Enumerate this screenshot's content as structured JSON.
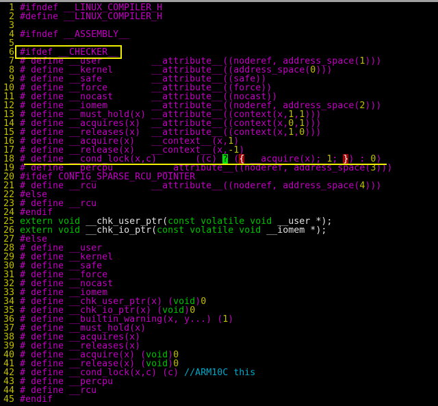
{
  "colors": {
    "preproc": "#c000c0",
    "number": "#c0c000",
    "type": "#00c000",
    "comment": "#00a8c8",
    "match": "#a80000",
    "cursor": "#00e000",
    "highlight": "#f0f000"
  },
  "lines": [
    [
      [
        "p",
        "#ifndef __LINUX_COMPILER_H"
      ]
    ],
    [
      [
        "p",
        "#define __LINUX_COMPILER_H"
      ]
    ],
    [],
    [
      [
        "p",
        "#ifndef __ASSEMBLY__"
      ]
    ],
    [],
    [
      [
        "p",
        "#ifdef __CHECKER__"
      ]
    ],
    [
      [
        "p",
        "# define __user         __attribute__((noderef, address_space("
      ],
      [
        "n",
        "1"
      ],
      [
        "p",
        ")))"
      ]
    ],
    [
      [
        "p",
        "# define __kernel       __attribute__((address_space("
      ],
      [
        "n",
        "0"
      ],
      [
        "p",
        ")))"
      ]
    ],
    [
      [
        "p",
        "# define __safe         __attribute__((safe))"
      ]
    ],
    [
      [
        "p",
        "# define __force        __attribute__((force))"
      ]
    ],
    [
      [
        "p",
        "# define __nocast       __attribute__((nocast))"
      ]
    ],
    [
      [
        "p",
        "# define __iomem        __attribute__((noderef, address_space("
      ],
      [
        "n",
        "2"
      ],
      [
        "p",
        ")))"
      ]
    ],
    [
      [
        "p",
        "# define __must_hold(x) __attribute__((context(x,"
      ],
      [
        "n",
        "1"
      ],
      [
        "p",
        ","
      ],
      [
        "n",
        "1"
      ],
      [
        "p",
        ")))"
      ]
    ],
    [
      [
        "p",
        "# define __acquires(x)  __attribute__((context(x,"
      ],
      [
        "n",
        "0"
      ],
      [
        "p",
        ","
      ],
      [
        "n",
        "1"
      ],
      [
        "p",
        ")))"
      ]
    ],
    [
      [
        "p",
        "# define __releases(x)  __attribute__((context(x,"
      ],
      [
        "n",
        "1"
      ],
      [
        "p",
        ","
      ],
      [
        "n",
        "0"
      ],
      [
        "p",
        ")))"
      ]
    ],
    [
      [
        "p",
        "# define __acquire(x)   __context__(x,"
      ],
      [
        "n",
        "1"
      ],
      [
        "p",
        ")"
      ]
    ],
    [
      [
        "p",
        "# define __release(x)   __context__(x,"
      ],
      [
        "n",
        "-1"
      ],
      [
        "p",
        ")"
      ]
    ],
    [
      [
        "p",
        "# define __cond_lock(x,c)       ((c) "
      ],
      [
        "s",
        "?"
      ],
      [
        "p",
        " ("
      ],
      [
        "r",
        "{"
      ],
      [
        "p",
        " __acquire(x); "
      ],
      [
        "n",
        "1"
      ],
      [
        "p",
        "; "
      ],
      [
        "r",
        "}"
      ],
      [
        "p",
        ") : "
      ],
      [
        "n",
        "0"
      ],
      [
        "p",
        ")"
      ]
    ],
    [
      [
        "p",
        "# define __percpu         __attribute__((noderef, address_space("
      ],
      [
        "n",
        "3"
      ],
      [
        "p",
        ")))"
      ]
    ],
    [
      [
        "p",
        "#ifdef CONFIG_SPARSE_RCU_POINTER"
      ]
    ],
    [
      [
        "p",
        "# define __rcu          __attribute__((noderef, address_space("
      ],
      [
        "n",
        "4"
      ],
      [
        "p",
        ")))"
      ]
    ],
    [
      [
        "p",
        "#else"
      ]
    ],
    [
      [
        "p",
        "# define __rcu"
      ]
    ],
    [
      [
        "p",
        "#endif"
      ]
    ],
    [
      [
        "t",
        "extern void "
      ],
      [
        "w",
        "__chk_user_ptr("
      ],
      [
        "t",
        "const volatile void "
      ],
      [
        "w",
        "__user *);"
      ]
    ],
    [
      [
        "t",
        "extern void "
      ],
      [
        "w",
        "__chk_io_ptr("
      ],
      [
        "t",
        "const volatile void "
      ],
      [
        "w",
        "__iomem *);"
      ]
    ],
    [
      [
        "p",
        "#else"
      ]
    ],
    [
      [
        "p",
        "# define __user"
      ]
    ],
    [
      [
        "p",
        "# define __kernel"
      ]
    ],
    [
      [
        "p",
        "# define __safe"
      ]
    ],
    [
      [
        "p",
        "# define __force"
      ]
    ],
    [
      [
        "p",
        "# define __nocast"
      ]
    ],
    [
      [
        "p",
        "# define __iomem"
      ]
    ],
    [
      [
        "p",
        "# define __chk_user_ptr(x) ("
      ],
      [
        "t",
        "void"
      ],
      [
        "p",
        ")"
      ],
      [
        "n",
        "0"
      ]
    ],
    [
      [
        "p",
        "# define __chk_io_ptr(x) ("
      ],
      [
        "t",
        "void"
      ],
      [
        "p",
        ")"
      ],
      [
        "n",
        "0"
      ]
    ],
    [
      [
        "p",
        "# define __builtin_warning(x, y...) ("
      ],
      [
        "n",
        "1"
      ],
      [
        "p",
        ")"
      ]
    ],
    [
      [
        "p",
        "# define __must_hold(x)"
      ]
    ],
    [
      [
        "p",
        "# define __acquires(x)"
      ]
    ],
    [
      [
        "p",
        "# define __releases(x)"
      ]
    ],
    [
      [
        "p",
        "# define __acquire(x) ("
      ],
      [
        "t",
        "void"
      ],
      [
        "p",
        ")"
      ],
      [
        "n",
        "0"
      ]
    ],
    [
      [
        "p",
        "# define __release(x) ("
      ],
      [
        "t",
        "void"
      ],
      [
        "p",
        ")"
      ],
      [
        "n",
        "0"
      ]
    ],
    [
      [
        "p",
        "# define __cond_lock(x,c) (c) "
      ],
      [
        "c",
        "//ARM10C this"
      ]
    ],
    [
      [
        "p",
        "# define __percpu"
      ]
    ],
    [
      [
        "p",
        "# define __rcu"
      ]
    ],
    [
      [
        "p",
        "#endif"
      ]
    ]
  ]
}
